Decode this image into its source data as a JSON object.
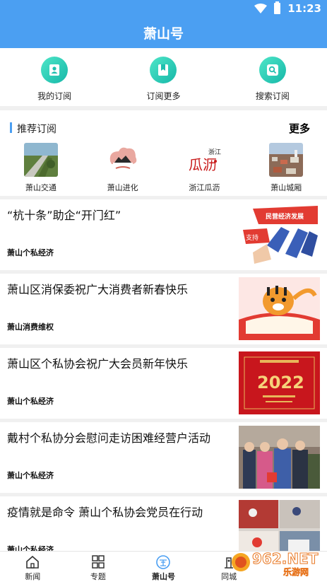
{
  "status_bar": {
    "time": "11:23"
  },
  "header": {
    "title": "萧山号"
  },
  "actions": [
    {
      "label": "我的订阅",
      "icon": "person-icon"
    },
    {
      "label": "订阅更多",
      "icon": "bookmark-icon"
    },
    {
      "label": "搜索订阅",
      "icon": "search-icon"
    }
  ],
  "recommend": {
    "title": "推荐订阅",
    "more": "更多",
    "items": [
      {
        "label": "萧山交通"
      },
      {
        "label": "萧山进化"
      },
      {
        "label": "浙江瓜沥"
      },
      {
        "label": "萧山城厢"
      }
    ]
  },
  "news": [
    {
      "headline": "“杭十条”助企“开门红”",
      "source": "萧山个私经济"
    },
    {
      "headline": "萧山区消保委祝广大消费者新春快乐",
      "source": "萧山消费维权"
    },
    {
      "headline": "萧山区个私协会祝广大会员新年快乐",
      "source": "萧山个私经济"
    },
    {
      "headline": "戴村个私协分会慰问走访困难经营户活动",
      "source": "萧山个私经济"
    },
    {
      "headline": "疫情就是命令 萧山个私协会党员在行动",
      "source": "萧山个私经济"
    }
  ],
  "pic_texts": {
    "news1_banner": "民营经济发展",
    "news1_sign": "支持",
    "news3_year": "2022"
  },
  "thumb_texts": {
    "guali_logo": "瓜沥",
    "guali_small": "浙江"
  },
  "tabbar": [
    {
      "label": "新闻",
      "icon": "home-icon"
    },
    {
      "label": "专题",
      "icon": "grid-icon"
    },
    {
      "label": "萧山号",
      "icon": "xiaoshanhao-icon",
      "active": true
    },
    {
      "label": "同城",
      "icon": "city-icon"
    }
  ],
  "watermark": {
    "main": "962.NET",
    "sub": "乐游网"
  },
  "colors": {
    "brand": "#4b9ff2",
    "accent": "#16b7a8"
  }
}
